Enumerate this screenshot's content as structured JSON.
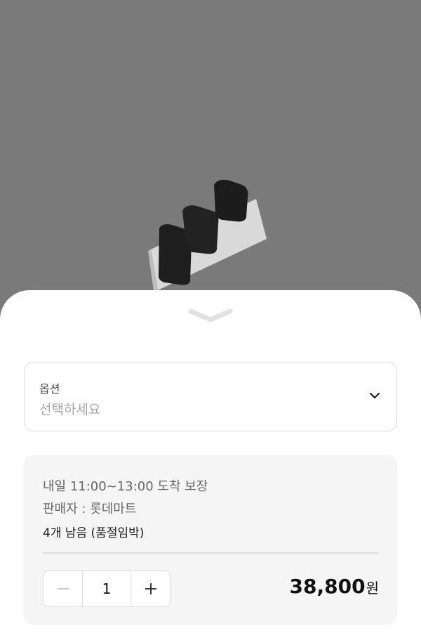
{
  "option": {
    "label": "옵션",
    "placeholder": "선택하세요"
  },
  "info": {
    "delivery": "내일 11:00~13:00 도착 보장",
    "seller": "판매자 : 롯데마트",
    "stock": "4개 남음 (품절임박)"
  },
  "quantity": {
    "value": "1"
  },
  "price": {
    "amount": "38,800",
    "currency": "원"
  },
  "icons": {
    "collapse": "chevron-down-icon",
    "dropdown": "chevron-down-icon",
    "minus": "minus-icon",
    "plus": "plus-icon"
  }
}
